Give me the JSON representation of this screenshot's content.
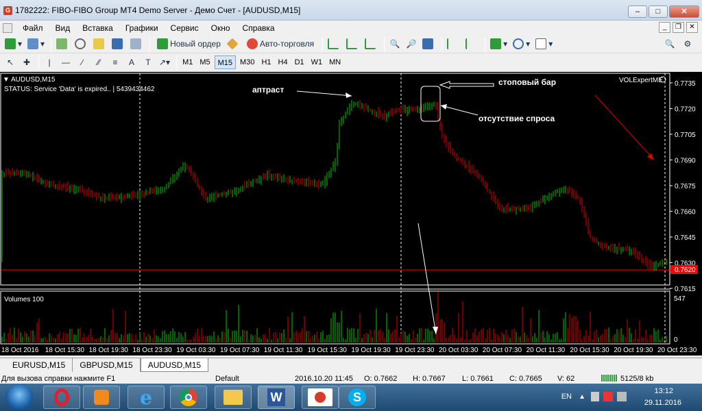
{
  "window": {
    "title": "1782222: FIBO-FIBO Group MT4 Demo Server - Демо Счет - [AUDUSD,M15]",
    "icon_label": "G"
  },
  "menu": {
    "items": [
      "Файл",
      "Вид",
      "Вставка",
      "Графики",
      "Сервис",
      "Окно",
      "Справка"
    ]
  },
  "toolbar": {
    "new_order": "Новый ордер",
    "auto_trading": "Авто-торговля"
  },
  "timeframes": [
    "M1",
    "M5",
    "M15",
    "M30",
    "H1",
    "H4",
    "D1",
    "W1",
    "MN"
  ],
  "active_timeframe": "M15",
  "chart": {
    "symbol_label": "AUDUSD,M15",
    "status_text": "STATUS:  Service 'Data' is expired.. | 5439434462",
    "indicator_name": "VOLExpertME",
    "volumes_label": "Volumes 100",
    "current_price": "0.7620",
    "price_ticks": [
      "0.7735",
      "0.7720",
      "0.7705",
      "0.7690",
      "0.7675",
      "0.7660",
      "0.7645",
      "0.7630",
      "0.7615"
    ],
    "volume_ticks": [
      "547",
      "0"
    ],
    "time_ticks": [
      "18 Oct 2016",
      "18 Oct 15:30",
      "18 Oct 19:30",
      "18 Oct 23:30",
      "19 Oct 03:30",
      "19 Oct 07:30",
      "19 Oct 11:30",
      "19 Oct 15:30",
      "19 Oct 19:30",
      "19 Oct 23:30",
      "20 Oct 03:30",
      "20 Oct 07:30",
      "20 Oct 11:30",
      "20 Oct 15:30",
      "20 Oct 19:30",
      "20 Oct 23:30"
    ],
    "annotations": {
      "uptrust": "аптраст",
      "stop_bar": "стоповый бар",
      "no_demand": "отсутствие спроса"
    },
    "colors": {
      "bull": "#00c800",
      "bear": "#e00000",
      "background": "#000000",
      "price_line": "#ff0000"
    }
  },
  "tabs": [
    "EURUSD,M15",
    "GBPUSD,M15",
    "AUDUSD,M15"
  ],
  "active_tab": "AUDUSD,M15",
  "status": {
    "help": "Для вызова справки нажмите F1",
    "profile": "Default",
    "datetime": "2016.10.20 11:45",
    "open": "O: 0.7662",
    "high": "H: 0.7667",
    "low": "L: 0.7661",
    "close": "C: 0.7665",
    "volume": "V: 62",
    "traffic": "5125/8 kb"
  },
  "taskbar": {
    "lang": "EN",
    "time": "13:12",
    "date": "29.11.2016"
  }
}
